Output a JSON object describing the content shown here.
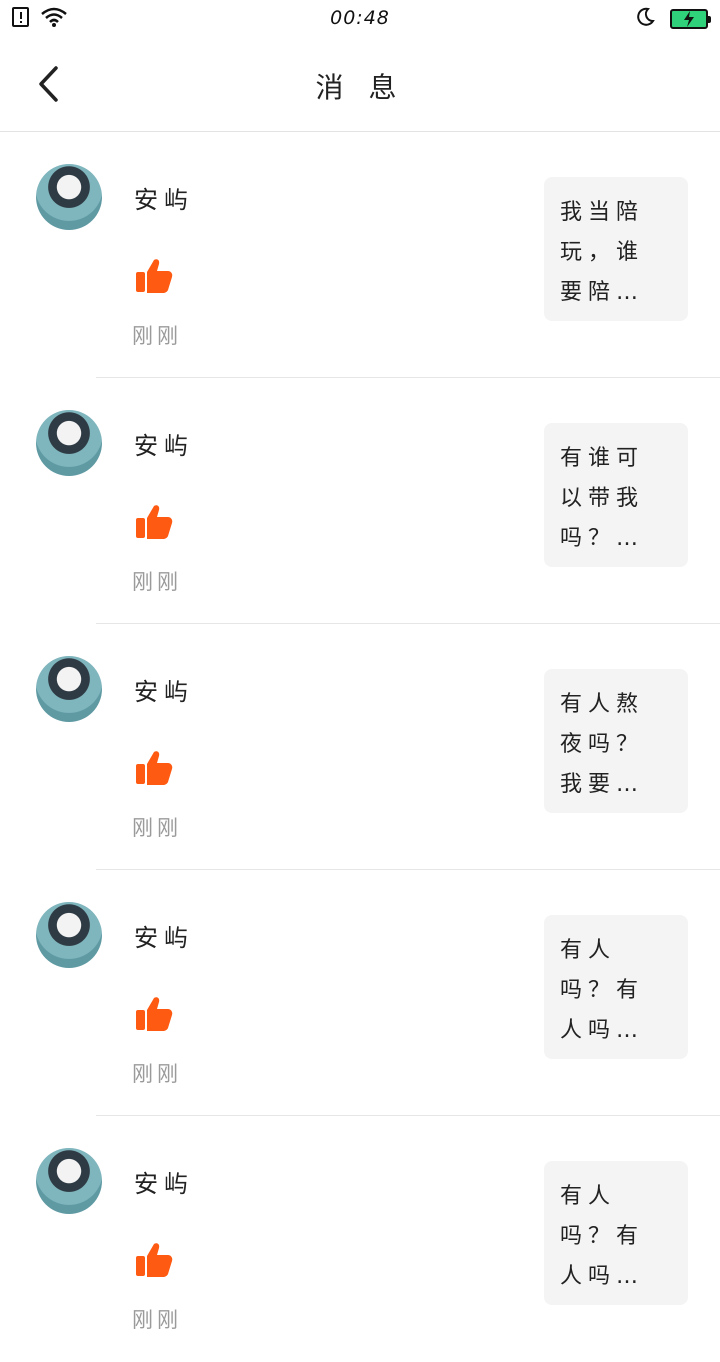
{
  "status_bar": {
    "time": "00:48",
    "battery_color": "#2fd17a"
  },
  "nav": {
    "title": "消 息"
  },
  "colors": {
    "like": "#ff5a12",
    "preview_bg": "#f4f4f4"
  },
  "messages": [
    {
      "username": "安屿",
      "time": "刚刚",
      "preview": [
        "我当陪",
        "玩，谁",
        "要陪…"
      ]
    },
    {
      "username": "安屿",
      "time": "刚刚",
      "preview": [
        "有谁可",
        "以带我",
        "吗？…"
      ]
    },
    {
      "username": "安屿",
      "time": "刚刚",
      "preview": [
        "有人熬",
        "夜吗？",
        "我要…"
      ]
    },
    {
      "username": "安屿",
      "time": "刚刚",
      "preview": [
        "有人",
        "吗？有",
        "人吗…"
      ]
    },
    {
      "username": "安屿",
      "time": "刚刚",
      "preview": [
        "有人",
        "吗？有",
        "人吗…"
      ]
    }
  ]
}
